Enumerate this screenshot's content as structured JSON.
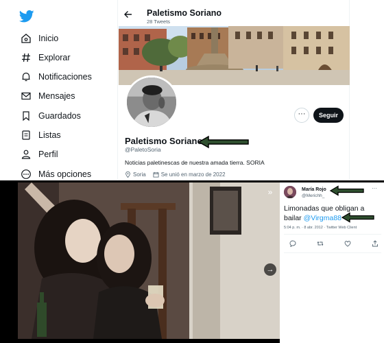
{
  "nav": {
    "items": [
      {
        "label": "Inicio",
        "icon": "home-icon"
      },
      {
        "label": "Explorar",
        "icon": "hashtag-icon"
      },
      {
        "label": "Notificaciones",
        "icon": "bell-icon"
      },
      {
        "label": "Mensajes",
        "icon": "mail-icon"
      },
      {
        "label": "Guardados",
        "icon": "bookmark-icon"
      },
      {
        "label": "Listas",
        "icon": "list-icon"
      },
      {
        "label": "Perfil",
        "icon": "person-icon"
      },
      {
        "label": "Más opciones",
        "icon": "more-circle-icon"
      }
    ],
    "brand_color": "#1d9bf0"
  },
  "profile": {
    "header_name": "Paletismo Soriano",
    "tweet_count": "28 Tweets",
    "name": "Paletismo Soriano",
    "handle": "@PaletoSoria",
    "bio": "Noticias paletinescas de nuestra amada tierra. SORIA",
    "location": "Soria",
    "joined": "Se unió en marzo de 2022",
    "follow_label": "Seguir",
    "more_label": "···"
  },
  "viewer": {
    "expand_label": "»",
    "next_label": "→"
  },
  "tweet": {
    "author_name": "María Rojo",
    "author_handle": "@Merichh_",
    "more_label": "···",
    "text": "Limonadas que obligan a bailar ",
    "mention": "@Virgma88",
    "meta": "5:04 p. m. · 8 abr. 2012 · Twitter Web Client",
    "mention_color": "#1d9bf0"
  },
  "annotation": {
    "arrow_color": "#000000",
    "arrow_fill": "#2f4f2f"
  }
}
